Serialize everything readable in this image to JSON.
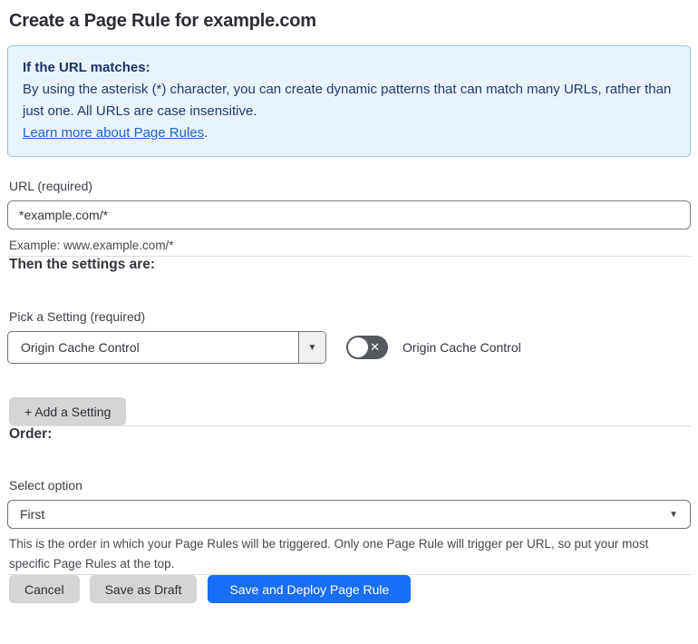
{
  "page": {
    "title": "Create a Page Rule for example.com"
  },
  "info_box": {
    "heading": "If the URL matches:",
    "body": "By using the asterisk (*) character, you can create dynamic patterns that can match many URLs, rather than just one. All URLs are case insensitive.",
    "link_label": "Learn more about Page Rules",
    "link_suffix": "."
  },
  "url_field": {
    "label": "URL (required)",
    "value": "*example.com/*",
    "helper": "Example: www.example.com/*"
  },
  "settings_section": {
    "heading": "Then the settings are:",
    "picker_label": "Pick a Setting (required)",
    "picker_value": "Origin Cache Control",
    "toggle_label": "Origin Cache Control",
    "toggle_state": "off",
    "add_setting_label": "+ Add a Setting"
  },
  "order_section": {
    "heading": "Order:",
    "select_label": "Select option",
    "select_value": "First",
    "helper": "This is the order in which your Page Rules will be triggered. Only one Page Rule will trigger per URL, so put your most specific Page Rules at the top."
  },
  "footer": {
    "cancel_label": "Cancel",
    "save_draft_label": "Save as Draft",
    "save_deploy_label": "Save and Deploy Page Rule"
  },
  "icons": {
    "dropdown_arrow": "▼",
    "toggle_off_x": "✕"
  },
  "colors": {
    "accent_blue": "#1a6ef5",
    "info_background": "#e9f3fc",
    "info_border": "#9cc2e6",
    "info_text": "#1c3c6b",
    "link_blue": "#2264c9",
    "toggle_off": "#55595e",
    "button_gray": "#d5d5d5"
  }
}
